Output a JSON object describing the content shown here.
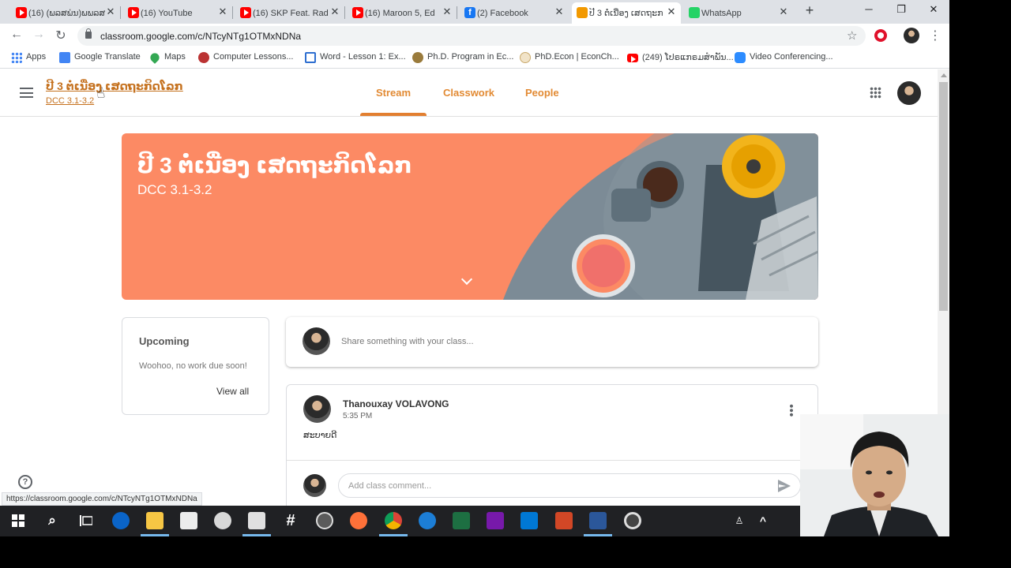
{
  "browser": {
    "tabs": [
      {
        "label": "(16) (ພລສພ່ນ)ພພລສ",
        "icon": "youtube-icon"
      },
      {
        "label": "(16) YouTube",
        "icon": "youtube-icon"
      },
      {
        "label": "(16) SKP Feat. Rad",
        "icon": "youtube-icon"
      },
      {
        "label": "(16) Maroon 5, Ed",
        "icon": "youtube-icon"
      },
      {
        "label": "(2) Facebook",
        "icon": "facebook-icon"
      },
      {
        "label": "ປີ 3 ຕໍ່ເນື່ອງ ເສດຖະກ",
        "icon": "classroom-icon",
        "active": true
      },
      {
        "label": "WhatsApp",
        "icon": "whatsapp-icon"
      }
    ],
    "new_tab": "+",
    "window_controls": {
      "minimize": "─",
      "restore": "❐",
      "close": "✕"
    },
    "nav": {
      "back": "←",
      "forward": "→",
      "reload": "↻"
    },
    "url": "classroom.google.com/c/NTcyNTg1OTMxNDNa",
    "bookmarks": [
      "Apps",
      "Google Translate",
      "Maps",
      "Computer Lessons...",
      "Word - Lesson 1: Ex...",
      "Ph.D. Program in Ec...",
      "PhD.Econ | EconCh...",
      "(249) ໂປຣແກຣມສຳພັນ...",
      "Video Conferencing..."
    ],
    "status_url": "https://classroom.google.com/c/NTcyNTg1OTMxNDNa"
  },
  "classroom": {
    "class_title": "ປີ 3 ຕໍ່ເນື່ອງ ເສດຖະກິດໂລກ",
    "class_section": "DCC 3.1-3.2",
    "tabs": [
      "Stream",
      "Classwork",
      "People"
    ],
    "active_tab": "Stream",
    "banner": {
      "title": "ປີ 3 ຕໍ່ເນື່ອງ ເສດຖະກິດໂລກ",
      "section": "DCC 3.1-3.2",
      "color": "#fc8a64"
    },
    "upcoming": {
      "title": "Upcoming",
      "text": "Woohoo, no work due soon!",
      "link": "View all"
    },
    "share_placeholder": "Share something with your class...",
    "post": {
      "author": "Thanouxay VOLAVONG",
      "time": "5:35 PM",
      "body": "ສະບາຍດີ",
      "comment_placeholder": "Add class comment..."
    },
    "help": "?"
  },
  "taskbar": {
    "search_glyph": "⌕",
    "hash_glyph": "#",
    "tray_chevron": "^"
  }
}
